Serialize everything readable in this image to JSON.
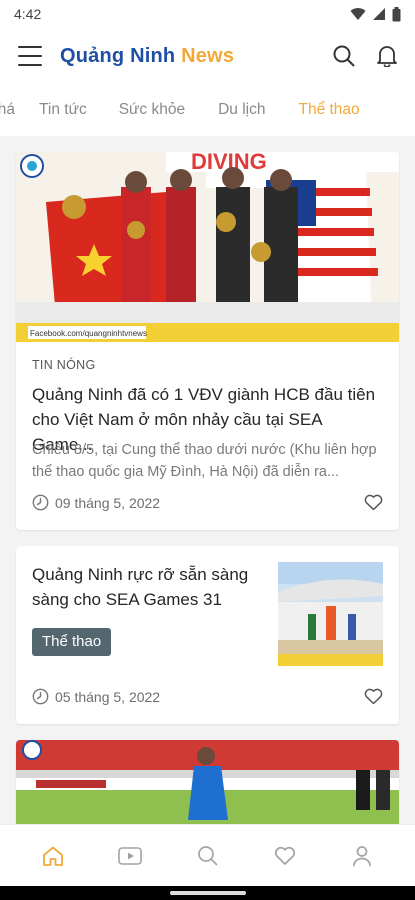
{
  "status_bar": {
    "time": "4:42"
  },
  "app": {
    "title_brand": "Quảng Ninh",
    "title_news": "News",
    "accent": "#f2a93b",
    "brand_color": "#1e4fa3"
  },
  "tabs": [
    {
      "label": "khá",
      "active": false
    },
    {
      "label": "Tin tức",
      "active": false
    },
    {
      "label": "Sức khỏe",
      "active": false
    },
    {
      "label": "Du lịch",
      "active": false
    },
    {
      "label": "Thể thao",
      "active": true
    }
  ],
  "articles": [
    {
      "tag": "TIN NÓNG",
      "title": "Quảng Ninh đã có 1 VĐV giành HCB đầu tiên cho Việt Nam ở môn nhảy cầu tại SEA Game...",
      "summary": "Chiều 8/5, tại Cung thể thao dưới nước (Khu liên hợp thể thao quốc gia Mỹ Đình, Hà Nội) đã diễn ra...",
      "date": "09 tháng 5, 2022",
      "image_banner_text": "DIVING",
      "image_caption": "Facebook.com/quangninhtvnews"
    },
    {
      "title": "Quảng Ninh rực rỡ sẵn sàng sàng cho SEA Games 31",
      "category": "Thể thao",
      "date": "05 tháng 5, 2022"
    },
    {
      "title": ""
    }
  ],
  "icons": {
    "menu": "menu-icon",
    "search": "search-icon",
    "notifications": "bell-icon",
    "clock": "clock-icon",
    "favorite": "heart-icon",
    "nav_home": "home-icon",
    "nav_video": "video-icon",
    "nav_search": "search-icon",
    "nav_favorites": "heart-icon",
    "nav_profile": "person-icon"
  }
}
